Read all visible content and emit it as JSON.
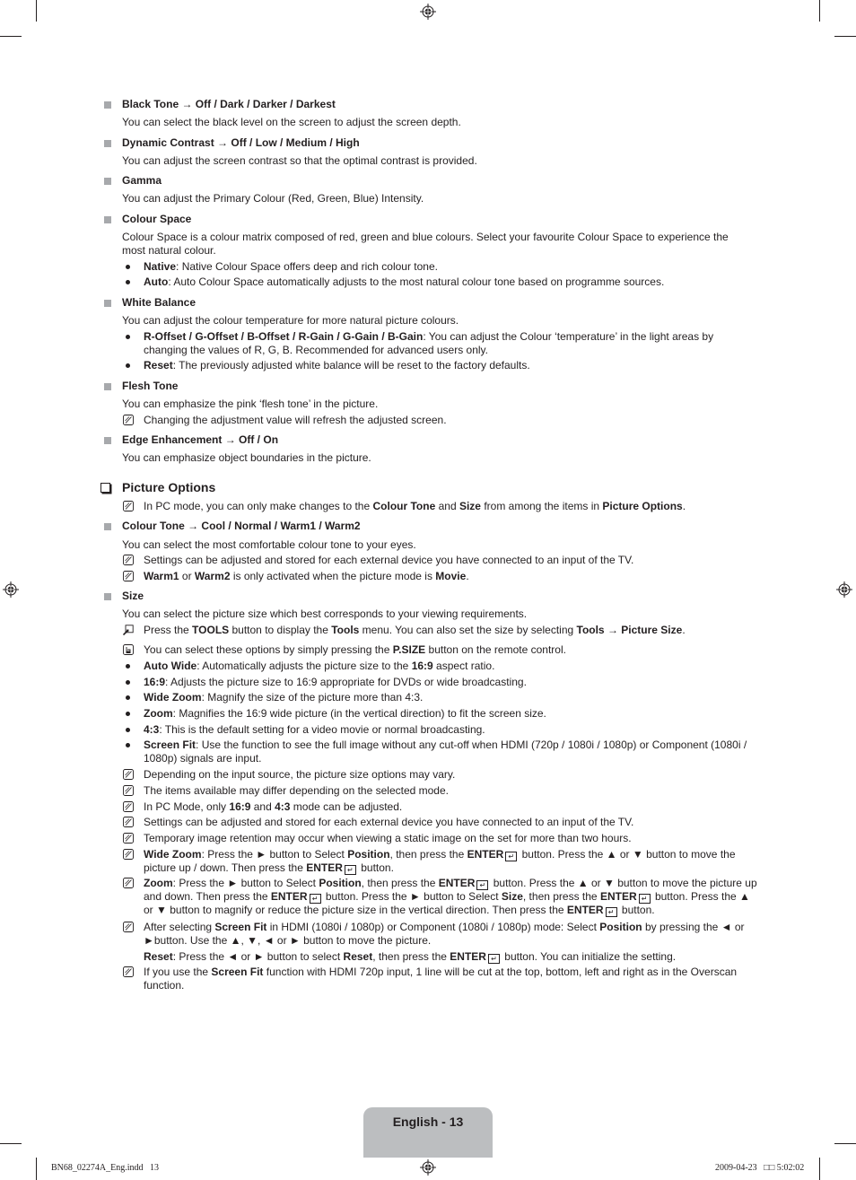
{
  "page": {
    "page_label": "English - 13",
    "slug_left": "BN68_02274A_Eng.indd   13",
    "slug_right": "2009-04-23   □□ 5:02:02"
  },
  "items": {
    "black_tone": {
      "title": "Black Tone → Off / Dark / Darker / Darkest",
      "desc": "You can select the black level on the screen to adjust the screen depth."
    },
    "dynamic_contrast": {
      "title": "Dynamic Contrast → Off / Low / Medium / High",
      "desc": "You can adjust the screen contrast so that the optimal contrast is provided."
    },
    "gamma": {
      "title": "Gamma",
      "desc": "You can adjust the Primary Colour (Red, Green, Blue) Intensity."
    },
    "colour_space": {
      "title": "Colour Space",
      "desc": "Colour Space is a colour matrix composed of red, green and blue colours. Select your favourite Colour Space to experience the most natural colour.",
      "bullets": [
        {
          "term": "Native",
          "text": ": Native Colour Space offers deep and rich colour tone."
        },
        {
          "term": "Auto",
          "text": ": Auto Colour Space automatically adjusts to the most natural colour tone based on programme sources."
        }
      ]
    },
    "white_balance": {
      "title": "White Balance",
      "desc": "You can adjust the colour temperature for more natural picture colours.",
      "bullets": [
        {
          "term": "R-Offset / G-Offset / B-Offset / R-Gain / G-Gain / B-Gain",
          "text": ": You can adjust the Colour ‘temperature’ in the light areas by changing the values of R, G, B. Recommended for advanced users only."
        },
        {
          "term": "Reset",
          "text": ": The previously adjusted white balance will be reset to the factory defaults."
        }
      ]
    },
    "flesh_tone": {
      "title": "Flesh Tone",
      "desc": "You can emphasize the pink ‘flesh tone’ in the picture.",
      "note": "Changing the adjustment value will refresh the adjusted screen."
    },
    "edge_enhancement": {
      "title": "Edge Enhancement → Off / On",
      "desc": "You can emphasize object boundaries in the picture."
    }
  },
  "picture_options": {
    "title": "Picture Options",
    "note": {
      "a": "In PC mode, you can only make changes to the ",
      "b1": "Colour Tone",
      "c": " and ",
      "b2": "Size",
      "d": " from among the items in ",
      "b3": "Picture Options",
      "e": "."
    },
    "colour_tone": {
      "title": "Colour Tone → Cool / Normal / Warm1 / Warm2",
      "desc": "You can select the most comfortable colour tone to your eyes.",
      "note1": "Settings can be adjusted and stored for each external device you have connected to an input of the TV.",
      "note2": {
        "b1": "Warm1",
        "a": " or ",
        "b2": "Warm2",
        "c": " is only activated when the picture mode is ",
        "b3": "Movie",
        "d": "."
      }
    },
    "size": {
      "title": "Size",
      "desc": "You can select the picture size which best corresponds to your viewing requirements.",
      "tools": {
        "a": "Press the ",
        "b1": "TOOLS",
        "c": " button to display the ",
        "b2": "Tools",
        "d": " menu. You can also set the size by selecting ",
        "b3": "Tools → Picture Size",
        "e": "."
      },
      "psize": {
        "a": "You can select these options by simply pressing the ",
        "b1": "P.SIZE",
        "c": " button on the remote control."
      },
      "bullets": [
        {
          "term": "Auto Wide",
          "text": ": Automatically adjusts the picture size to the ",
          "term2": "16:9",
          "text2": " aspect ratio."
        },
        {
          "term": "16:9",
          "text": ": Adjusts the picture size to 16:9 appropriate for DVDs or wide broadcasting."
        },
        {
          "term": "Wide Zoom",
          "text": ": Magnify the size of the picture more than 4:3."
        },
        {
          "term": "Zoom",
          "text": ": Magnifies the 16:9 wide picture (in the vertical direction) to fit the screen size."
        },
        {
          "term": "4:3",
          "text": ": This is the default setting for a video movie or normal broadcasting."
        },
        {
          "term": "Screen Fit",
          "text": ": Use the function to see the full image without any cut-off when HDMI (720p / 1080i / 1080p) or Component (1080i / 1080p) signals are input."
        }
      ],
      "notes": {
        "n1": "Depending on the input source, the picture size options may vary.",
        "n2": "The items available may differ depending on the selected mode.",
        "n3": {
          "a": "In PC Mode, only ",
          "b1": "16:9",
          "c": " and ",
          "b2": "4:3",
          "d": " mode can be adjusted."
        },
        "n4": "Settings can be adjusted and stored for each external device you have connected to an input of the TV.",
        "n5": "Temporary image retention may occur when viewing a static image on the set for more than two hours.",
        "n6": {
          "b1": "Wide Zoom",
          "a": ": Press the ► button to Select ",
          "b2": "Position",
          "c": ", then press the ",
          "b3": "ENTER",
          "d": " button. Press the ▲ or ▼ button to move the picture up / down. Then press the ",
          "b4": "ENTER",
          "e": " button."
        },
        "n7": {
          "b1": "Zoom",
          "a": ": Press the ► button to Select ",
          "b2": "Position",
          "c": ", then press the ",
          "b3": "ENTER",
          "d": " button. Press the ▲ or ▼ button to move the picture up and down. Then press the ",
          "b4": "ENTER",
          "e": " button. Press the ► button to Select ",
          "b5": "Size",
          "f": ", then press the ",
          "b6": "ENTER",
          "g": " button. Press the ▲ or ▼ button to magnify or reduce the picture size in the vertical direction. Then press the ",
          "b7": "ENTER",
          "h": " button."
        },
        "n8": {
          "a": "After selecting ",
          "b1": "Screen Fit",
          "c": " in HDMI (1080i / 1080p) or Component (1080i / 1080p) mode: Select ",
          "b2": "Position",
          "d": " by pressing the ◄ or ►button. Use the ▲, ▼, ◄ or ► button to move the picture."
        },
        "n8b": {
          "b1": "Reset",
          "a": ": Press the ◄ or ► button to select ",
          "b2": "Reset",
          "c": ", then press the ",
          "b3": "ENTER",
          "d": " button. You can initialize the setting."
        },
        "n9": {
          "a": "If you use the ",
          "b1": "Screen Fit",
          "c": " function with HDMI 720p input, 1 line will be cut at the top, bottom, left and right as in the Overscan function."
        }
      }
    }
  }
}
